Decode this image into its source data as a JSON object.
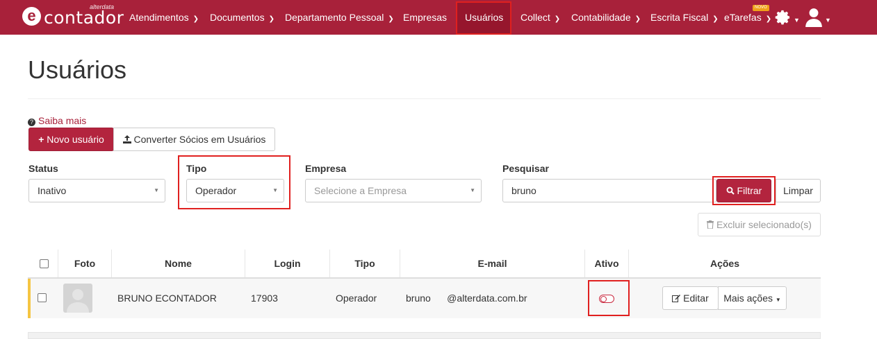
{
  "nav": {
    "logo_e": "e",
    "logo_text": "contador",
    "logo_sub": "alterdata",
    "items": [
      {
        "label": "Atendimentos"
      },
      {
        "label": "Documentos"
      },
      {
        "label": "Departamento Pessoal"
      },
      {
        "label": "Empresas"
      },
      {
        "label": "Usuários"
      },
      {
        "label": "Collect"
      },
      {
        "label": "Contabilidade"
      },
      {
        "label": "Escrita Fiscal"
      },
      {
        "label": "eTarefas"
      }
    ],
    "new_badge": "NOVO",
    "icons": [
      "gear-icon",
      "user-icon"
    ]
  },
  "page": {
    "title": "Usuários",
    "help_link": "Saiba mais",
    "new_user_button": "Novo usuário",
    "convert_button": "Converter Sócios em Usuários"
  },
  "filters": {
    "status_label": "Status",
    "status_value": "Inativo",
    "tipo_label": "Tipo",
    "tipo_value": "Operador",
    "empresa_label": "Empresa",
    "empresa_placeholder": "Selecione a Empresa",
    "search_label": "Pesquisar",
    "search_value": "bruno",
    "filter_button": "Filtrar",
    "clear_button": "Limpar",
    "delete_selected_button": "Excluir selecionado(s)"
  },
  "table": {
    "headers": [
      "Foto",
      "Nome",
      "Login",
      "Tipo",
      "E-mail",
      "Ativo",
      "Ações"
    ],
    "rows": [
      {
        "nome": "BRUNO ECONTADOR",
        "login": "17903",
        "tipo": "Operador",
        "email": "bruno      @alterdata.com.br",
        "ativo": false,
        "edit_button": "Editar",
        "more_button": "Mais ações"
      }
    ]
  },
  "colors": {
    "brand": "#a8213a",
    "highlight": "#e0201f",
    "row_marker": "#f5c542"
  }
}
